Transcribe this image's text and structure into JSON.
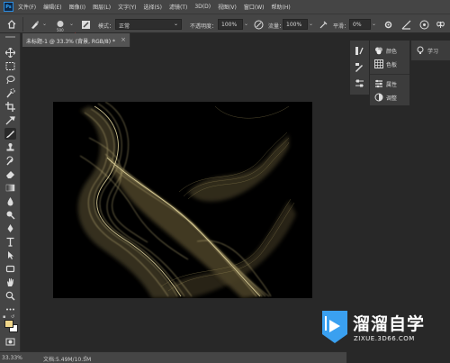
{
  "app": {
    "logo_text": "Ps"
  },
  "menu": [
    "文件(F)",
    "编辑(E)",
    "图像(I)",
    "图层(L)",
    "文字(Y)",
    "选择(S)",
    "滤镜(T)",
    "3D(D)",
    "视图(V)",
    "窗口(W)",
    "帮助(H)"
  ],
  "options": {
    "brush_size": "500",
    "mode_label": "模式：",
    "mode_value": "正常",
    "opacity_label": "不透明度：",
    "opacity_value": "100%",
    "flow_label": "流量：",
    "flow_value": "100%",
    "smoothing_label": "平滑：",
    "smoothing_value": "0%"
  },
  "document": {
    "tab_label": "未标题-1 @ 33.3% (背景, RGB/8) *",
    "close_symbol": "×"
  },
  "status": {
    "zoom": "33.33%",
    "doc_info": "文档:5.49M/10.5M",
    "arrow": "›"
  },
  "panels": {
    "color": "颜色",
    "swatches": "色板",
    "properties": "属性",
    "adjustments": "调整",
    "learn": "学习"
  },
  "watermark": {
    "name": "溜溜自学",
    "url": "ZIXUE.3D66.COM"
  },
  "colors": {
    "annotation_arrow": "#e8302c",
    "smoke": "#d9c98a",
    "foreground": "#f0d68a",
    "background": "#ffffff",
    "watermark_badge": "#3aa0f0"
  },
  "icons": {
    "toolbar": [
      "move-icon",
      "marquee-icon",
      "lasso-icon",
      "quick-select-icon",
      "crop-icon",
      "eyedropper-icon",
      "brush-icon",
      "stamp-icon",
      "history-brush-icon",
      "eraser-icon",
      "gradient-icon",
      "blur-icon",
      "dodge-icon",
      "pen-icon",
      "type-icon",
      "path-select-icon",
      "rectangle-icon",
      "hand-icon",
      "zoom-icon",
      "more-icon"
    ]
  }
}
